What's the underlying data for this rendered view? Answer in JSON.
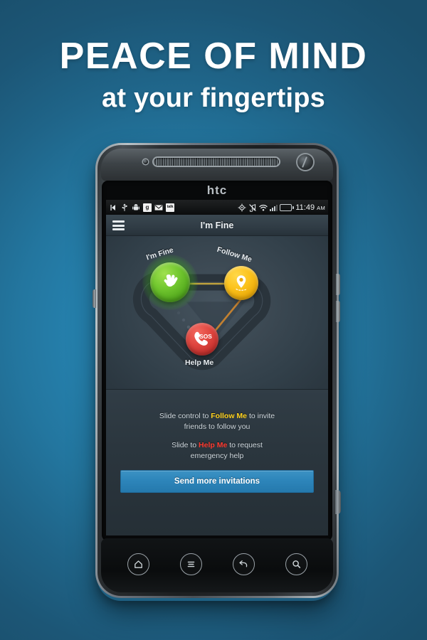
{
  "promo": {
    "headline_line1": "PEACE OF MIND",
    "headline_line2": "at your fingertips",
    "background_top_color": "#1e5571",
    "background_mid_color": "#2786b5"
  },
  "device": {
    "brand_logo": "htc",
    "speaker_icon": "speaker-grille-icon",
    "front_camera_icon": "front-camera-icon",
    "proximity_sensor_icon": "proximity-sensor-icon"
  },
  "status_bar": {
    "left_icons": [
      {
        "name": "back-arrow-icon",
        "label": ""
      },
      {
        "name": "usb-icon",
        "label": ""
      },
      {
        "name": "android-robot-icon",
        "label": ""
      },
      {
        "name": "google-search-icon",
        "label": "g"
      },
      {
        "name": "gmail-icon",
        "label": "M"
      },
      {
        "name": "google-talk-icon",
        "label": "talk"
      }
    ],
    "right_icons": [
      {
        "name": "gps-location-icon",
        "label": ""
      },
      {
        "name": "sound-muted-icon",
        "label": ""
      },
      {
        "name": "wifi-icon",
        "label": ""
      },
      {
        "name": "cellular-signal-icon",
        "label": ""
      },
      {
        "name": "battery-icon",
        "label": ""
      }
    ],
    "time": "11:49",
    "time_period": "AM",
    "battery_color": "#6cbf1d"
  },
  "app": {
    "menu_icon": "hamburger-menu-icon",
    "title": "I'm Fine"
  },
  "control": {
    "nodes": [
      {
        "id": "im-fine",
        "label": "I'm Fine",
        "icon": "ok-hand-gesture-icon",
        "color": "#6cc32b",
        "state": "active"
      },
      {
        "id": "follow-me",
        "label": "Follow Me",
        "icon": "map-pin-icon",
        "color": "#fcc31c",
        "state": "inactive"
      },
      {
        "id": "help-me",
        "label": "Help Me",
        "icon": "sos-phone-icon",
        "icon_text": "SOS",
        "color": "#e04740",
        "state": "inactive"
      }
    ]
  },
  "instructions": {
    "line1_a": "Slide control to",
    "line1_keyword": "Follow Me",
    "line1_b": "to invite",
    "line1_c": "friends to follow you",
    "line2_a": "Slide to",
    "line2_keyword": "Help Me",
    "line2_b": "to request",
    "line2_c": "emergency help",
    "keyword_follow_color": "#ffd21e",
    "keyword_help_color": "#ff3b30"
  },
  "actions": {
    "send_invitations_label": "Send more invitations",
    "send_invitations_color": "#2d85ba"
  },
  "hardware_nav": [
    {
      "name": "home-button",
      "icon": "home-icon"
    },
    {
      "name": "menu-button",
      "icon": "menu-lines-icon"
    },
    {
      "name": "back-button",
      "icon": "back-arrow-icon"
    },
    {
      "name": "search-button",
      "icon": "search-icon"
    }
  ]
}
